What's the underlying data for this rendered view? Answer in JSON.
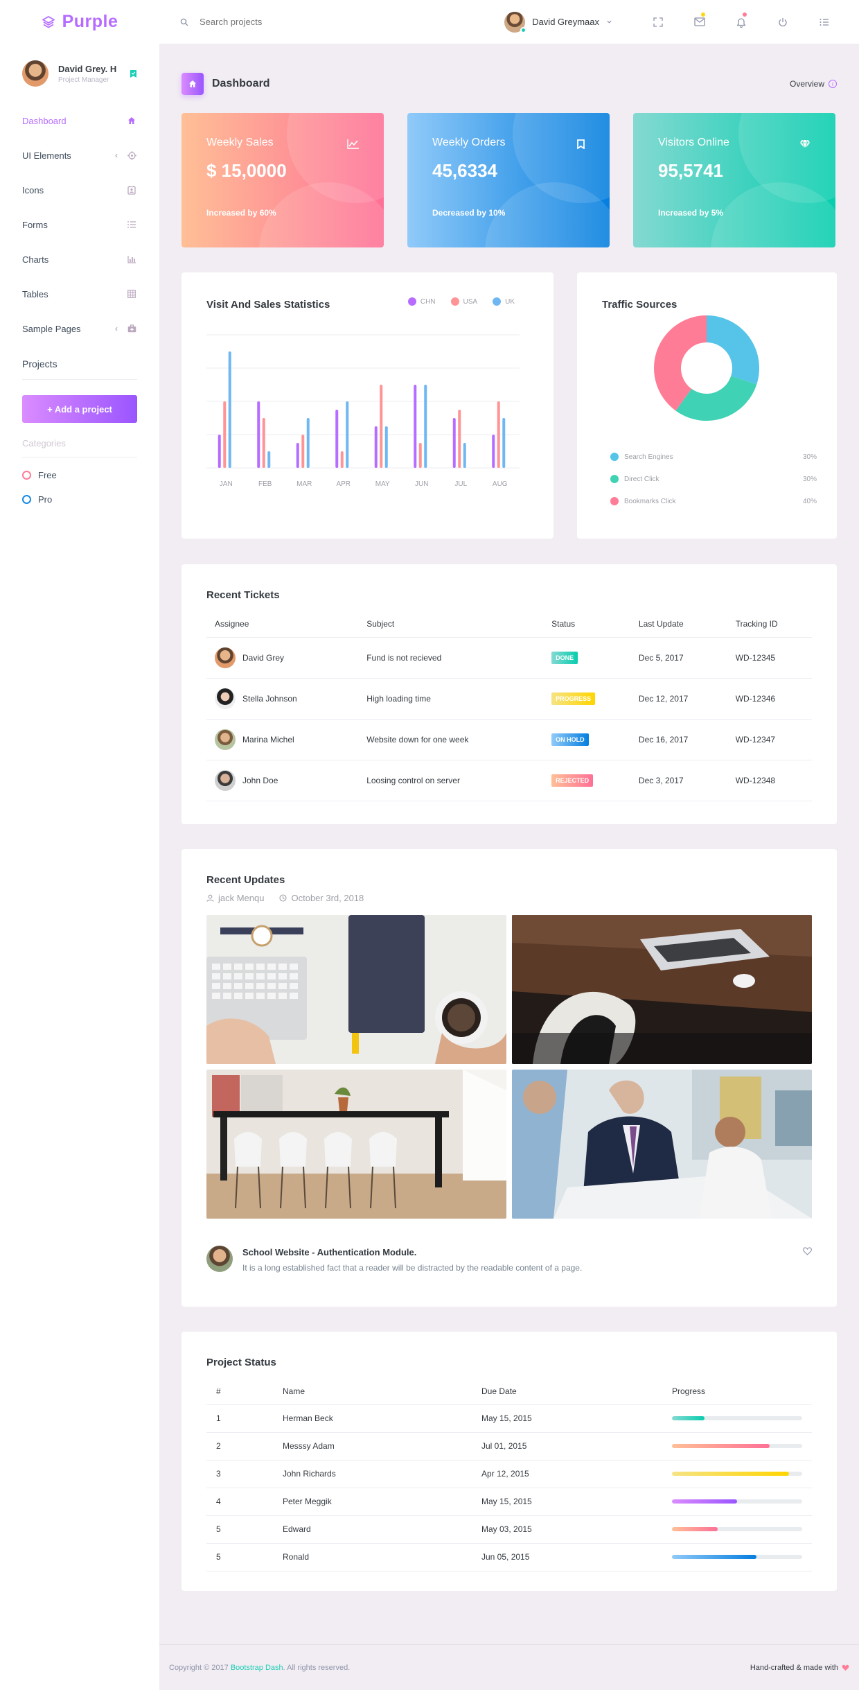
{
  "brand": {
    "name": "Purple"
  },
  "navbar": {
    "search_placeholder": "Search projects",
    "profile_name": "David Greymaax",
    "icons": [
      "fullscreen-icon",
      "mail-icon",
      "bell-icon",
      "power-icon",
      "menu-icon"
    ],
    "colors": {
      "mail_badge": "#fed713",
      "bell_badge": "#fe7c96",
      "online": "#1bcfb4"
    }
  },
  "sidebar": {
    "profile": {
      "name": "David Grey. H",
      "role": "Project Manager"
    },
    "items": [
      {
        "label": "Dashboard",
        "icon": "home-icon",
        "active": true,
        "chevron": false
      },
      {
        "label": "UI Elements",
        "icon": "crosshairs-icon",
        "active": false,
        "chevron": true
      },
      {
        "label": "Icons",
        "icon": "contacts-icon",
        "active": false,
        "chevron": false
      },
      {
        "label": "Forms",
        "icon": "format-list-icon",
        "active": false,
        "chevron": false
      },
      {
        "label": "Charts",
        "icon": "chart-bar-icon",
        "active": false,
        "chevron": false
      },
      {
        "label": "Tables",
        "icon": "table-icon",
        "active": false,
        "chevron": false
      },
      {
        "label": "Sample Pages",
        "icon": "medical-bag-icon",
        "active": false,
        "chevron": true
      }
    ],
    "projects_title": "Projects",
    "add_project": "+ Add a project",
    "categories_title": "Categories",
    "categories": [
      {
        "label": "Free",
        "color": "#fe7c96"
      },
      {
        "label": "Pro",
        "color": "#198ae3"
      }
    ]
  },
  "page": {
    "title": "Dashboard",
    "overview": "Overview"
  },
  "stats": [
    {
      "title": "Weekly Sales",
      "value": "$ 15,0000",
      "sub": "Increased by 60%",
      "icon": "chart-line-icon",
      "gradient": [
        "#ffbf96",
        "#fe7096"
      ]
    },
    {
      "title": "Weekly Orders",
      "value": "45,6334",
      "sub": "Decreased by 10%",
      "icon": "bookmark-icon",
      "gradient": [
        "#90caf9",
        "#047edf"
      ]
    },
    {
      "title": "Visitors Online",
      "value": "95,5741",
      "sub": "Increased by 5%",
      "icon": "diamond-icon",
      "gradient": [
        "#84d9d2",
        "#07cdae"
      ]
    }
  ],
  "visit_chart": {
    "title": "Visit And Sales Statistics"
  },
  "traffic": {
    "title": "Traffic Sources"
  },
  "chart_data": [
    {
      "type": "bar",
      "title": "Visit And Sales Statistics",
      "categories": [
        "JAN",
        "FEB",
        "MAR",
        "APR",
        "MAY",
        "JUN",
        "JUL",
        "AUG"
      ],
      "series": [
        {
          "name": "CHN",
          "color": "#b66dff",
          "values": [
            20,
            40,
            15,
            35,
            25,
            50,
            30,
            20
          ]
        },
        {
          "name": "USA",
          "color": "#fe9496",
          "values": [
            40,
            30,
            20,
            10,
            50,
            15,
            35,
            40
          ]
        },
        {
          "name": "UK",
          "color": "#6fb7f2",
          "values": [
            70,
            10,
            30,
            40,
            25,
            50,
            15,
            30
          ]
        }
      ],
      "ylim": [
        0,
        80
      ],
      "grid": true,
      "legend": "top-right",
      "xlabel": "",
      "ylabel": ""
    },
    {
      "type": "pie",
      "title": "Traffic Sources",
      "categories": [
        "Search Engines",
        "Direct Click",
        "Bookmarks Click"
      ],
      "values": [
        30,
        30,
        40
      ],
      "labels": [
        "30%",
        "30%",
        "40%"
      ],
      "colors": [
        "#55c4e8",
        "#3fd2b5",
        "#fe7c96"
      ],
      "legend": "bottom"
    }
  ],
  "tickets": {
    "title": "Recent Tickets",
    "columns": [
      "Assignee",
      "Subject",
      "Status",
      "Last Update",
      "Tracking ID"
    ],
    "rows": [
      {
        "assignee": "David Grey",
        "subject": "Fund is not recieved",
        "status": "DONE",
        "status_color": "#1bcfb4",
        "date": "Dec 5, 2017",
        "id": "WD-12345"
      },
      {
        "assignee": "Stella Johnson",
        "subject": "High loading time",
        "status": "PROGRESS",
        "status_color": "#fed713",
        "date": "Dec 12, 2017",
        "id": "WD-12346"
      },
      {
        "assignee": "Marina Michel",
        "subject": "Website down for one week",
        "status": "ON HOLD",
        "status_color": "#198ae3",
        "date": "Dec 16, 2017",
        "id": "WD-12347"
      },
      {
        "assignee": "John Doe",
        "subject": "Loosing control on server",
        "status": "REJECTED",
        "status_color": "#fe7c96",
        "date": "Dec 3, 2017",
        "id": "WD-12348"
      }
    ]
  },
  "updates": {
    "title": "Recent Updates",
    "author": "jack Menqu",
    "date": "October 3rd, 2018",
    "photos": [
      "workspace-keyboard-coffee",
      "laptop-on-desk",
      "dining-room-chairs",
      "business-meeting"
    ],
    "post_title": "School Website - Authentication Module.",
    "post_text": "It is a long established fact that a reader will be distracted by the readable content of a page."
  },
  "project_status": {
    "title": "Project Status",
    "columns": [
      "#",
      "Name",
      "Due Date",
      "Progress"
    ],
    "rows": [
      {
        "num": "1",
        "name": "Herman Beck",
        "due": "May 15, 2015",
        "progress": 25,
        "color": "#1bcfb4"
      },
      {
        "num": "2",
        "name": "Messsy Adam",
        "due": "Jul 01, 2015",
        "progress": 75,
        "color": "#fe7c96"
      },
      {
        "num": "3",
        "name": "John Richards",
        "due": "Apr 12, 2015",
        "progress": 90,
        "color": "#fed713"
      },
      {
        "num": "4",
        "name": "Peter Meggik",
        "due": "May 15, 2015",
        "progress": 50,
        "color": "#b66dff"
      },
      {
        "num": "5",
        "name": "Edward",
        "due": "May 03, 2015",
        "progress": 35,
        "color": "#fe7c96"
      },
      {
        "num": "5",
        "name": "Ronald",
        "due": "Jun 05, 2015",
        "progress": 65,
        "color": "#198ae3"
      }
    ]
  },
  "footer": {
    "copyright_prefix": "Copyright © 2017 ",
    "link": "Bootstrap Dash",
    "copyright_suffix": ". All rights reserved.",
    "right": "Hand-crafted & made with"
  }
}
